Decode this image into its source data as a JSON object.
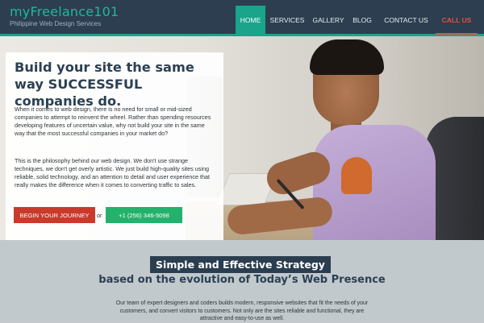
{
  "header": {
    "brand": "myFreelance101",
    "tagline": "Philippine Web Design Services"
  },
  "nav": {
    "items": [
      {
        "label": "HOME",
        "active": true
      },
      {
        "label": "SERVICES",
        "active": false
      },
      {
        "label": "GALLERY",
        "active": false
      },
      {
        "label": "BLOG",
        "active": false
      },
      {
        "label": "CONTACT US",
        "active": false
      },
      {
        "label": "CALL US",
        "active": false
      }
    ]
  },
  "hero": {
    "title": "Build your site the same way SUCCESSFUL companies do.",
    "paragraph1": "When it comes to web design, there is no need for small or mid-sized companies to attempt to reinvent the wheel. Rather than spending resources developing features of uncertain value, why not build your site in the same way that the most successful companies in your market do?",
    "paragraph2": "This is the philosophy behind our web design. We don't use strange techniques, we don't get overly artistic. We just build high-quality sites using reliable, solid technology, and an attention to detail and user experience that really makes the difference when it comes to converting traffic to sales.",
    "cta_primary": "BEGIN YOUR JOURNEY",
    "cta_or": "or",
    "cta_phone": "+1 (256) 346-5098"
  },
  "strategy": {
    "title": "Simple and Effective Strategy",
    "subtitle": "based on the evolution of Today’s Web Presence",
    "body": "Our team of expert designers and coders builds modern, responsive websites that fit the needs of your customers, and convert visitors to customers. Not only are the sites reliable and functional, they are attractive and easy-to-use as well."
  },
  "colors": {
    "header_bg": "#2c3e50",
    "accent_teal": "#19a48b",
    "call_red": "#e0523d",
    "cta_red": "#c93a2b",
    "cta_green": "#23b26b",
    "section_bg": "#c2c9cd"
  }
}
